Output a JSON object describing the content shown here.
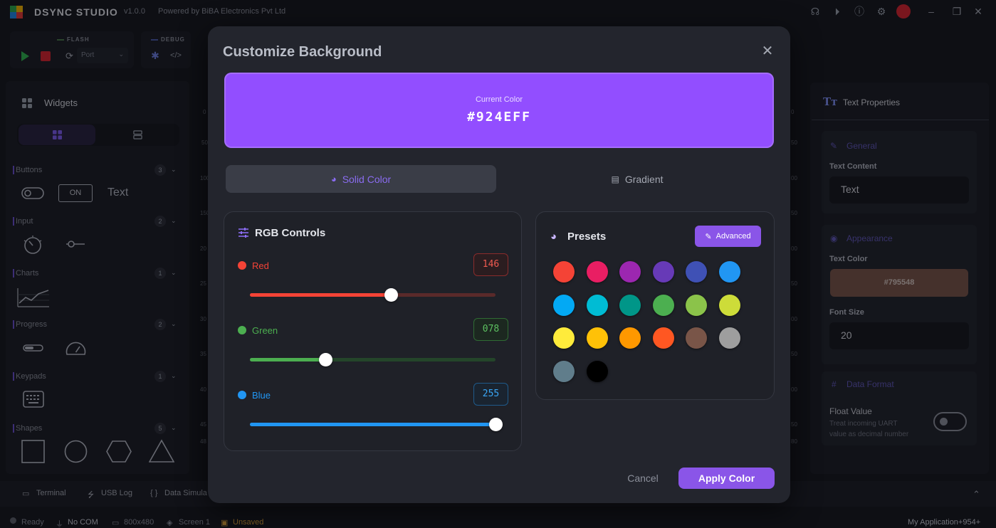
{
  "app": {
    "name": "DSYNC STUDIO",
    "version": "v1.0.0",
    "powered_by": "Powered by BiBA Electronics Pvt Ltd"
  },
  "toolbar": {
    "flash_label": "FLASH",
    "debug_label": "DEBUG",
    "port_placeholder": "Port"
  },
  "sidebar": {
    "title": "Widgets",
    "categories": [
      {
        "label": "Buttons",
        "count": "3"
      },
      {
        "label": "Input",
        "count": "2"
      },
      {
        "label": "Charts",
        "count": "1"
      },
      {
        "label": "Progress",
        "count": "2"
      },
      {
        "label": "Keypads",
        "count": "1"
      },
      {
        "label": "Shapes",
        "count": "5"
      }
    ],
    "on_button_label": "ON",
    "text_widget_label": "Text"
  },
  "ruler": {
    "left": [
      "0",
      "50",
      "100",
      "150",
      "20",
      "25",
      "30",
      "35",
      "40",
      "45",
      "48"
    ],
    "right": [
      "0",
      "50",
      "00",
      "50",
      "00",
      "50",
      "00",
      "50",
      "00",
      "50",
      "80"
    ]
  },
  "properties": {
    "title": "Text Properties",
    "general_section": "General",
    "text_content_label": "Text Content",
    "text_content_value": "Text",
    "appearance_section": "Appearance",
    "text_color_label": "Text Color",
    "text_color_value": "#795548",
    "font_size_label": "Font Size",
    "font_size_value": "20",
    "data_format_section": "Data Format",
    "float_value_label": "Float Value",
    "float_value_desc_1": "Treat incoming UART",
    "float_value_desc_2": "value as decimal number"
  },
  "bottom_tabs": [
    "Terminal",
    "USB Log",
    "Data Simula"
  ],
  "status": {
    "ready": "Ready",
    "com": "No COM",
    "resolution": "800x480",
    "screen": "Screen 1",
    "unsaved": "Unsaved",
    "app_right": "My Application+954+"
  },
  "modal": {
    "title": "Customize Background",
    "current_color_label": "Current Color",
    "current_color_hex": "#924EFF",
    "tab_solid": "Solid Color",
    "tab_gradient": "Gradient",
    "rgb_title": "RGB Controls",
    "channels": [
      {
        "name": "Red",
        "value": "146",
        "fraction": 0.573,
        "color": "#f44336"
      },
      {
        "name": "Green",
        "value": "078",
        "fraction": 0.306,
        "color": "#4caf50"
      },
      {
        "name": "Blue",
        "value": "255",
        "fraction": 1.0,
        "color": "#2196f3"
      }
    ],
    "presets_title": "Presets",
    "advanced_label": "Advanced",
    "presets": [
      "#f44336",
      "#e91e63",
      "#9c27b0",
      "#673ab7",
      "#3f51b5",
      "#2196f3",
      "#03a9f4",
      "#00bcd4",
      "#009688",
      "#4caf50",
      "#8bc34a",
      "#cddc39",
      "#ffeb3b",
      "#ffc107",
      "#ff9800",
      "#ff5722",
      "#795548",
      "#9e9e9e",
      "#607d8b",
      "#000000"
    ],
    "cancel_label": "Cancel",
    "apply_label": "Apply Color"
  }
}
